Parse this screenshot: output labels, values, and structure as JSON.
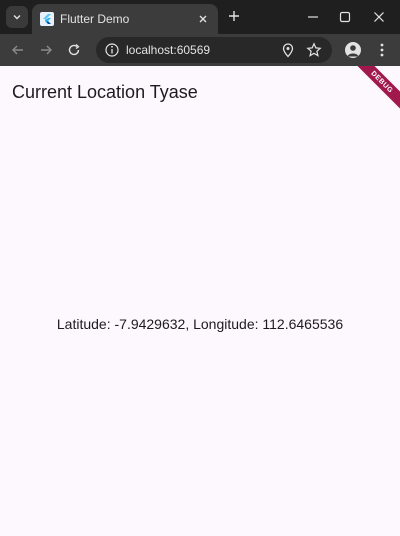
{
  "browser": {
    "tab_title": "Flutter Demo",
    "url": "localhost:60569",
    "icons": [
      "tab-list-icon",
      "flutter-favicon",
      "close-icon",
      "plus-icon",
      "minimize-icon",
      "maximize-icon",
      "close-window-icon",
      "back-icon",
      "forward-icon",
      "reload-icon",
      "info-icon",
      "location-icon",
      "star-icon",
      "profile-icon",
      "menu-icon"
    ]
  },
  "app": {
    "title": "Current Location Tyase",
    "location_text": "Latitude: -7.9429632, Longitude: 112.6465536",
    "debug_label": "DEBUG",
    "colors": {
      "background": "#fdf7fe",
      "text": "#1d1b20",
      "debug_banner": "#a1194c"
    }
  }
}
